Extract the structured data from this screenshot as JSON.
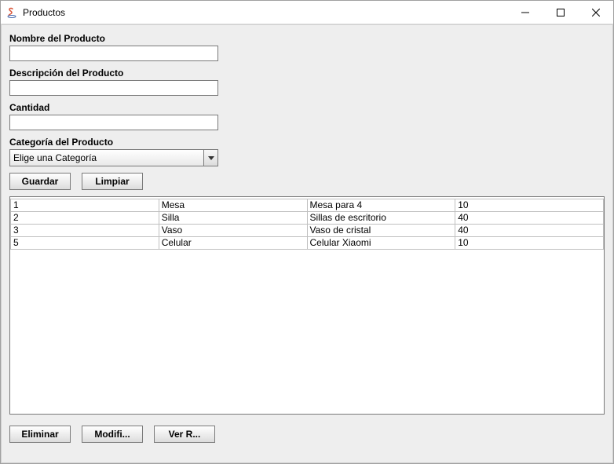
{
  "window": {
    "title": "Productos"
  },
  "form": {
    "name_label": "Nombre del Producto",
    "name_value": "",
    "desc_label": "Descripción del Producto",
    "desc_value": "",
    "qty_label": "Cantidad",
    "qty_value": "",
    "category_label": "Categoría del Producto",
    "category_selected": "Elige una Categoría"
  },
  "buttons": {
    "save": "Guardar",
    "clear": "Limpiar",
    "delete": "Eliminar",
    "modify": "Modifi...",
    "view": "Ver R..."
  },
  "table": {
    "rows": [
      {
        "id": "1",
        "name": "Mesa",
        "desc": "Mesa para 4",
        "qty": "10"
      },
      {
        "id": "2",
        "name": "Silla",
        "desc": "Sillas de escritorio",
        "qty": "40"
      },
      {
        "id": "3",
        "name": "Vaso",
        "desc": "Vaso de cristal",
        "qty": "40"
      },
      {
        "id": "5",
        "name": "Celular",
        "desc": "Celular Xiaomi",
        "qty": "10"
      }
    ]
  }
}
